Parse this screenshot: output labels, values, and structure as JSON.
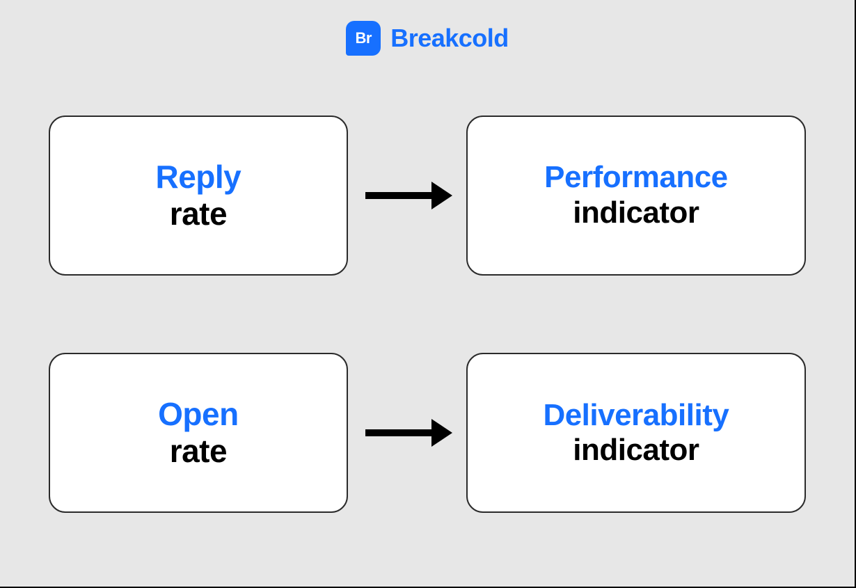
{
  "brand": {
    "badge_text": "Br",
    "name": "Breakcold",
    "color": "#1770ff"
  },
  "rows": [
    {
      "left": {
        "line1": "Reply",
        "line2": "rate"
      },
      "right": {
        "line1": "Performance",
        "line2": "indicator"
      }
    },
    {
      "left": {
        "line1": "Open",
        "line2": "rate"
      },
      "right": {
        "line1": "Deliverability",
        "line2": "indicator"
      }
    }
  ]
}
